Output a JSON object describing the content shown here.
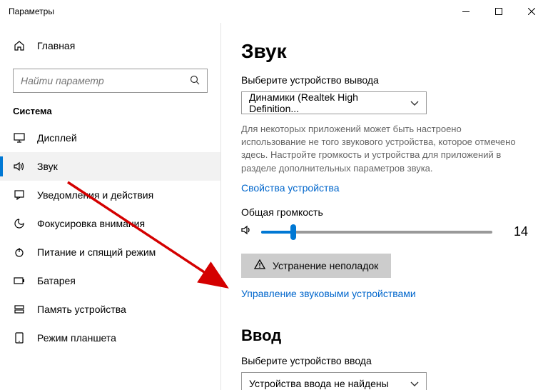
{
  "window": {
    "title": "Параметры"
  },
  "sidebar": {
    "home": "Главная",
    "search_placeholder": "Найти параметр",
    "section": "Система",
    "items": [
      {
        "label": "Дисплей"
      },
      {
        "label": "Звук"
      },
      {
        "label": "Уведомления и действия"
      },
      {
        "label": "Фокусировка внимания"
      },
      {
        "label": "Питание и спящий режим"
      },
      {
        "label": "Батарея"
      },
      {
        "label": "Память устройства"
      },
      {
        "label": "Режим планшета"
      }
    ]
  },
  "sound": {
    "heading": "Звук",
    "output_label": "Выберите устройство вывода",
    "output_device": "Динамики (Realtek High Definition...",
    "help": "Для некоторых приложений может быть настроено использование не того звукового устройства, которое отмечено здесь. Настройте громкость и устройства для приложений в разделе дополнительных параметров звука.",
    "device_props": "Свойства устройства",
    "overall_volume": "Общая громкость",
    "volume_value": "14",
    "troubleshoot": "Устранение неполадок",
    "manage_devices": "Управление звуковыми устройствами",
    "input_heading": "Ввод",
    "input_label": "Выберите устройство ввода",
    "input_device": "Устройства ввода не найдены"
  }
}
